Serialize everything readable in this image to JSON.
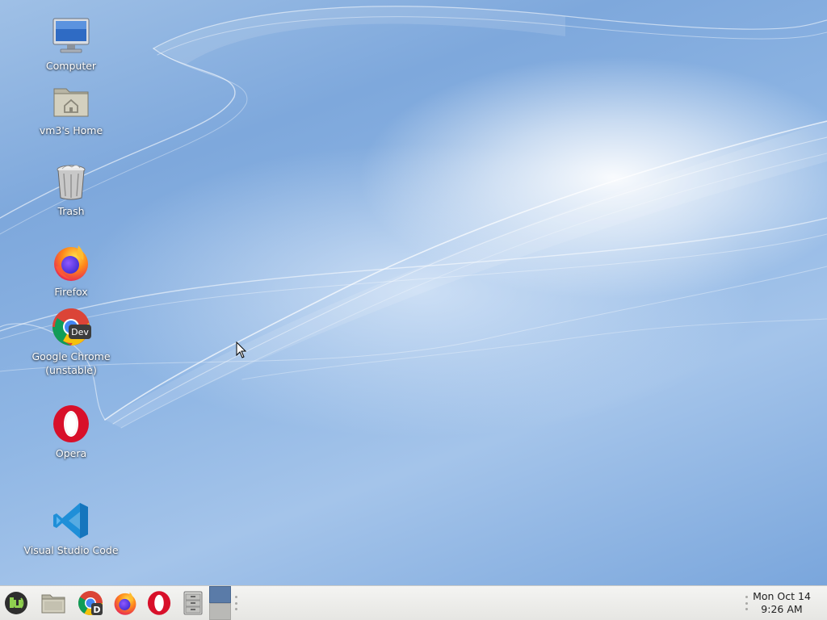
{
  "desktop": {
    "icons": [
      {
        "label": "Computer",
        "icon": "computer-icon"
      },
      {
        "label": "vm3's Home",
        "icon": "home-folder-icon"
      },
      {
        "label": "Trash",
        "icon": "trash-icon"
      },
      {
        "label": "Firefox",
        "icon": "firefox-icon"
      },
      {
        "label": "Google Chrome\n(unstable)",
        "icon": "chrome-dev-icon",
        "badge": "Dev"
      },
      {
        "label": "Opera",
        "icon": "opera-icon"
      },
      {
        "label": "Visual Studio Code",
        "icon": "vscode-icon"
      }
    ]
  },
  "taskbar": {
    "launchers": [
      {
        "name": "menu",
        "icon": "mint-menu-icon"
      },
      {
        "name": "files",
        "icon": "file-manager-icon"
      },
      {
        "name": "chrome-dev",
        "icon": "chrome-dev-icon",
        "badge": "D"
      },
      {
        "name": "firefox",
        "icon": "firefox-icon"
      },
      {
        "name": "opera",
        "icon": "opera-icon"
      },
      {
        "name": "cabinet",
        "icon": "filing-cabinet-icon"
      }
    ],
    "workspaces": 2,
    "active_workspace": 1,
    "clock": {
      "date": "Mon Oct 14",
      "time": "9:26 AM"
    }
  },
  "colors": {
    "desktop_blue": "#8fb6e4",
    "taskbar_bg": "#ececea",
    "workspace_active": "#5a7ba8"
  }
}
